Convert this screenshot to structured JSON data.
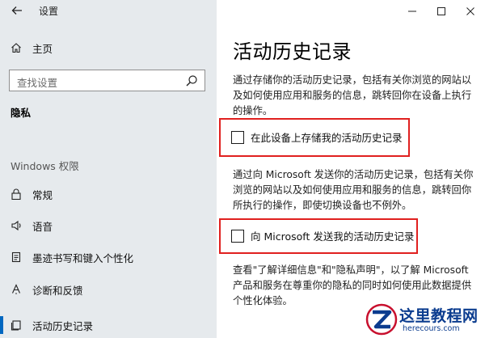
{
  "app": {
    "title": "设置"
  },
  "sidebar": {
    "home_label": "主页",
    "search_placeholder": "查找设置",
    "section_heading": "隐私",
    "group_heading": "Windows 权限",
    "items": [
      {
        "label": "常规",
        "icon": "lock-icon"
      },
      {
        "label": "语音",
        "icon": "microphone-icon"
      },
      {
        "label": "墨迹书写和键入个性化",
        "icon": "notepad-icon"
      },
      {
        "label": "诊断和反馈",
        "icon": "feedback-icon"
      },
      {
        "label": "活动历史记录",
        "icon": "history-icon"
      }
    ],
    "active_index": 4
  },
  "main": {
    "title": "活动历史记录",
    "desc1": "通过存储你的活动历史记录，包括有关你浏览的网站以及如何使用应用和服务的信息，跳转回你在设备上执行的操作。",
    "checkbox1_label": "在此设备上存储我的活动历史记录",
    "checkbox1_checked": false,
    "desc2": "通过向 Microsoft 发送你的活动历史记录，包括有关你浏览的网站以及如何使用应用和服务的信息，跳转回你所执行的操作，即使切换设备也不例外。",
    "checkbox2_label": "向 Microsoft 发送我的活动历史记录",
    "checkbox2_checked": false,
    "desc3": "查看\"了解详细信息\"和\"隐私声明\"，以了解 Microsoft 产品和服务在尊重你的隐私的同时如何使用此数据提供个性化体验。"
  },
  "window_controls": {
    "minimize": "—",
    "maximize": "☐",
    "close": "✕"
  },
  "watermark": {
    "title": "这里教程网",
    "url": "herecours.com"
  },
  "colors": {
    "sidebar_bg": "#e6eaed",
    "accent": "#0067c0",
    "highlight": "#e0201f",
    "watermark": "#0b3c8f"
  }
}
